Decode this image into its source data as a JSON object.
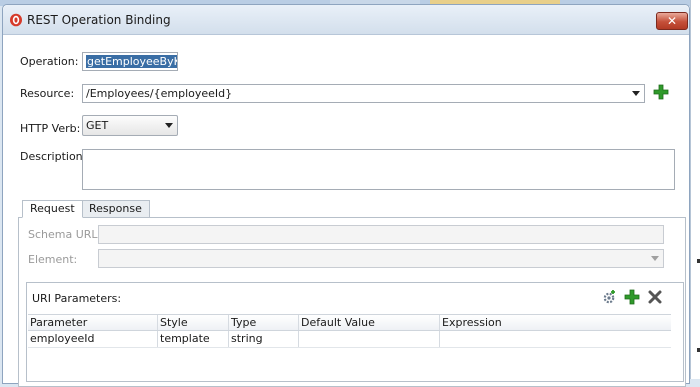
{
  "window": {
    "title": "REST Operation Binding",
    "close_symbol": "✕"
  },
  "form": {
    "operation_label": "Operation:",
    "operation_value": "getEmployeeByKey",
    "resource_label": "Resource:",
    "resource_value": "/Employees/{employeeId}",
    "http_verb_label": "HTTP Verb:",
    "http_verb_value": "GET",
    "description_label": "Description:",
    "description_value": ""
  },
  "tabs": [
    {
      "label": "Request",
      "active": true
    },
    {
      "label": "Response",
      "active": false
    }
  ],
  "request": {
    "schema_url_label": "Schema URL:",
    "schema_url_value": "",
    "element_label": "Element:",
    "element_value": ""
  },
  "uri_parameters": {
    "title": "URI Parameters:",
    "columns": [
      "Parameter",
      "Style",
      "Type",
      "Default Value",
      "Expression"
    ],
    "rows": [
      [
        "employeeId",
        "template",
        "string",
        "",
        ""
      ]
    ]
  },
  "icons": {
    "app": "oracle-logo-icon",
    "add_resource": "plus-icon",
    "generate": "gear-icon",
    "add_parameter": "plus-icon",
    "remove_parameter": "delete-x-icon"
  },
  "colors": {
    "accent_green": "#2f9a2a",
    "close_red": "#c5503a",
    "selection_blue": "#3a6ea5"
  }
}
